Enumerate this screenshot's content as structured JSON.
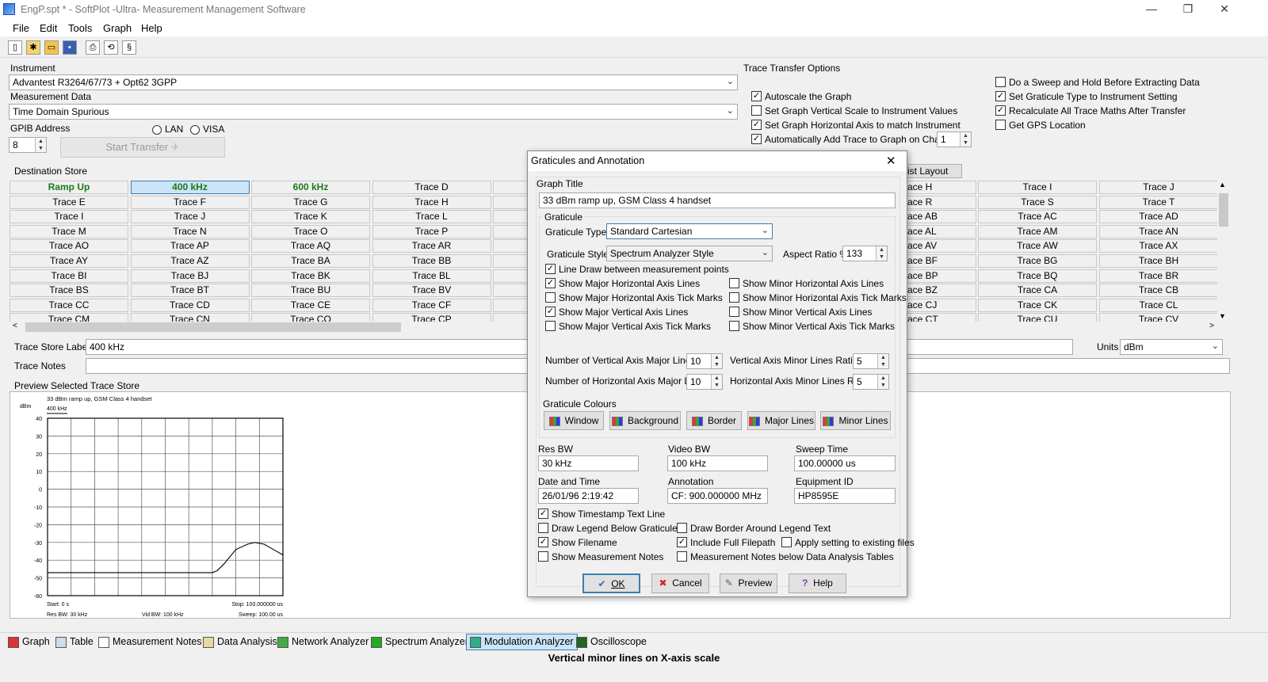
{
  "window": {
    "title": "EngP.spt * - SoftPlot -Ultra- Measurement Management Software",
    "minimize": "—",
    "restore": "❐",
    "close": "✕"
  },
  "menu": [
    "File",
    "Edit",
    "Tools",
    "Graph",
    "Help"
  ],
  "instrument": {
    "label": "Instrument",
    "value": "Advantest R3264/67/73 + Opt62 3GPP",
    "measurement_label": "Measurement Data",
    "measurement_value": "Time Domain Spurious",
    "gpib_label": "GPIB Address",
    "gpib_value": "8",
    "lan": "LAN",
    "visa": "VISA",
    "start_transfer": "Start Transfer"
  },
  "transfer_options": {
    "title": "Trace Transfer Options",
    "left": [
      {
        "label": "Autoscale the Graph",
        "checked": true
      },
      {
        "label": "Set Graph Vertical Scale to Instrument Values",
        "checked": false
      },
      {
        "label": "Set Graph Horizontal Axis to match Instrument",
        "checked": true
      },
      {
        "label": "Automatically Add Trace to Graph on Channel",
        "checked": true
      }
    ],
    "channel": "1",
    "right": [
      {
        "label": "Do a Sweep and Hold Before Extracting Data",
        "checked": false
      },
      {
        "label": "Set Graticule Type to Instrument Setting",
        "checked": true
      },
      {
        "label": "Recalculate All Trace Maths After Transfer",
        "checked": true
      },
      {
        "label": "Get GPS Location",
        "checked": false
      }
    ],
    "list_layout": "ist Layout"
  },
  "destination": {
    "label": "Destination Store",
    "rows_left": [
      [
        "Ramp Up",
        "400 kHz",
        "600 kHz",
        "Trace D"
      ],
      [
        "Trace E",
        "Trace F",
        "Trace G",
        "Trace H"
      ],
      [
        "Trace I",
        "Trace J",
        "Trace K",
        "Trace L"
      ],
      [
        "Trace M",
        "Trace N",
        "Trace O",
        "Trace P"
      ],
      [
        "Trace AO",
        "Trace AP",
        "Trace AQ",
        "Trace AR"
      ],
      [
        "Trace AY",
        "Trace AZ",
        "Trace BA",
        "Trace BB"
      ],
      [
        "Trace BI",
        "Trace BJ",
        "Trace BK",
        "Trace BL"
      ],
      [
        "Trace BS",
        "Trace BT",
        "Trace BU",
        "Trace BV"
      ],
      [
        "Trace CC",
        "Trace CD",
        "Trace CE",
        "Trace CF"
      ],
      [
        "Trace CM",
        "Trace CN",
        "Trace CO",
        "Trace CP"
      ]
    ],
    "rows_right": [
      [
        "race H",
        "Trace I",
        "Trace J"
      ],
      [
        "race R",
        "Trace S",
        "Trace T"
      ],
      [
        "race AB",
        "Trace AC",
        "Trace AD"
      ],
      [
        "race AL",
        "Trace AM",
        "Trace AN"
      ],
      [
        "race AV",
        "Trace AW",
        "Trace AX"
      ],
      [
        "race BF",
        "Trace BG",
        "Trace BH"
      ],
      [
        "race BP",
        "Trace BQ",
        "Trace BR"
      ],
      [
        "race BZ",
        "Trace CA",
        "Trace CB"
      ],
      [
        "race CJ",
        "Trace CK",
        "Trace CL"
      ],
      [
        "race CT",
        "Trace CU",
        "Trace CV"
      ]
    ]
  },
  "trace_store": {
    "label_caption": "Trace Store Label",
    "label_value": "400 kHz",
    "notes_caption": "Trace Notes",
    "units_caption": "Units",
    "units_value": "dBm",
    "preview_caption": "Preview Selected Trace Store"
  },
  "chart_data": {
    "type": "line",
    "title": "33 dBm ramp up, GSM Class 4 handset",
    "series": [
      {
        "name": "400 kHz",
        "x": [
          0,
          10,
          20,
          30,
          40,
          45,
          48,
          52,
          56,
          60,
          65,
          70,
          72,
          75,
          80,
          85,
          88,
          92,
          96,
          100
        ],
        "y": [
          -47,
          -47,
          -47,
          -47,
          -47,
          -47,
          -47,
          -47,
          -47,
          -47,
          -47,
          -47,
          -46,
          -42,
          -34,
          -31,
          -30,
          -31,
          -34,
          -37
        ]
      }
    ],
    "ylabel": "dBm",
    "ylim": [
      -60,
      40
    ],
    "yticks": [
      "40",
      "30",
      "20",
      "10",
      "0",
      "-10",
      "-20",
      "-30",
      "-40",
      "-50",
      "-60"
    ],
    "xlim": [
      0,
      100
    ],
    "grid": true,
    "footer": {
      "start": "Start: 0 s",
      "stop": "Stop: 100.000000 us",
      "res_bw": "Res BW: 30 kHz",
      "vid_bw": "Vid BW: 100 kHz",
      "sweep": "Sweep: 100.00 us"
    }
  },
  "dialog": {
    "title": "Graticules and Annotation",
    "graph_title_label": "Graph Title",
    "graph_title_value": "33 dBm ramp up, GSM Class 4 handset",
    "graticule_group": "Graticule",
    "graticule_type_label": "Graticule Type",
    "graticule_type_value": "Standard Cartesian",
    "graticule_style_label": "Graticule Style",
    "graticule_style_value": "Spectrum Analyzer Style",
    "aspect_label": "Aspect Ratio %",
    "aspect_value": "133",
    "checks_left": [
      {
        "label": "Line Draw between measurement points",
        "checked": true
      },
      {
        "label": "Show Major Horizontal Axis Lines",
        "checked": true
      },
      {
        "label": "Show Major Horizontal Axis Tick Marks",
        "checked": false
      },
      {
        "label": "Show Major Vertical Axis Lines",
        "checked": true
      },
      {
        "label": "Show Major Vertical Axis Tick Marks",
        "checked": false
      }
    ],
    "checks_right": [
      {
        "label": "Show Minor Horizontal Axis Lines",
        "checked": false
      },
      {
        "label": "Show Minor Horizontal Axis Tick Marks",
        "checked": false
      },
      {
        "label": "Show Minor Vertical Axis Lines",
        "checked": false
      },
      {
        "label": "Show Minor Vertical Axis Tick Marks",
        "checked": false
      }
    ],
    "num_vert_label": "Number of Vertical Axis Major Lines",
    "num_vert_value": "10",
    "num_horiz_label": "Number of Horizontal Axis Major Lines",
    "num_horiz_value": "10",
    "vert_minor_label": "Vertical Axis Minor Lines Ratio",
    "vert_minor_value": "5",
    "horiz_minor_label": "Horizontal Axis Minor Lines Ratio",
    "horiz_minor_value": "5",
    "colours_label": "Graticule Colours",
    "colour_buttons": [
      "Window",
      "Background",
      "Border",
      "Major Lines",
      "Minor Lines"
    ],
    "res_bw_label": "Res BW",
    "res_bw_value": "30 kHz",
    "video_bw_label": "Video BW",
    "video_bw_value": "100 kHz",
    "sweep_label": "Sweep Time",
    "sweep_value": "100.00000 us",
    "date_label": "Date and Time",
    "date_value": "26/01/96 2:19:42",
    "annotation_label": "Annotation",
    "annotation_value": "CF: 900.000000 MHz",
    "equip_label": "Equipment ID",
    "equip_value": "HP8595E",
    "bottom_checks": [
      {
        "label": "Show Timestamp Text Line",
        "checked": true
      },
      {
        "label": "Draw Legend Below Graticule",
        "checked": false
      },
      {
        "label": "Draw Border Around Legend Text",
        "checked": false
      },
      {
        "label": "Show Filename",
        "checked": true
      },
      {
        "label": "Include Full Filepath",
        "checked": true
      },
      {
        "label": "Apply setting to existing files",
        "checked": false
      },
      {
        "label": "Show Measurement Notes",
        "checked": false
      },
      {
        "label": "Measurement Notes below Data Analysis Tables",
        "checked": false
      }
    ],
    "ok": "OK",
    "cancel": "Cancel",
    "preview": "Preview",
    "help": "Help"
  },
  "bottom_tabs": [
    "Graph",
    "Table",
    "Measurement Notes",
    "Data Analysis",
    "Network Analyzer",
    "Spectrum Analyzer",
    "Modulation Analyzer",
    "Oscilloscope"
  ],
  "status": "Vertical minor lines on X-axis scale"
}
